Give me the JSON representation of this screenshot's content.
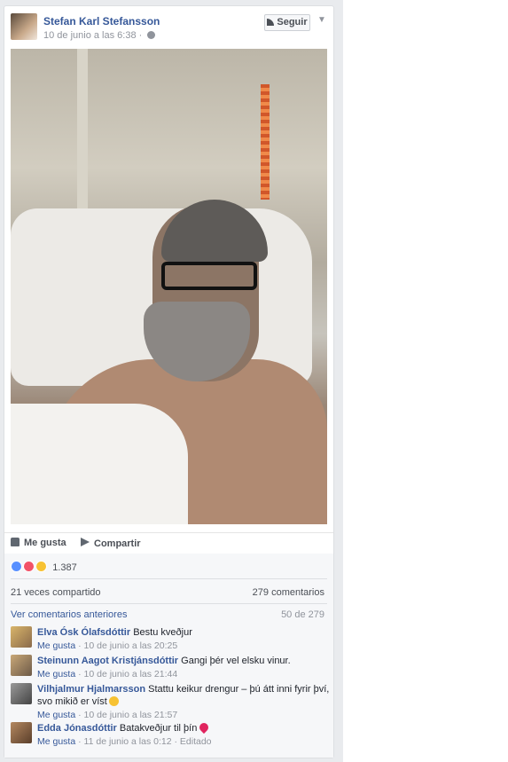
{
  "post": {
    "author": "Stefan Karl Stefansson",
    "timestamp": "10 de junio a las 6:38 ·",
    "follow_label": "Seguir",
    "actions": {
      "like": "Me gusta",
      "share": "Compartir"
    },
    "reactions_count": "1.387",
    "shared": "21 veces compartido",
    "comments_total": "279 comentarios",
    "view_previous": "Ver comentarios anteriores",
    "pager": "50 de 279"
  },
  "comments": [
    {
      "name": "Elva Ósk Ólafsdóttir",
      "text": "Bestu kveðjur",
      "like": "Me gusta",
      "meta": " · 10 de junio a las 20:25"
    },
    {
      "name": "Steinunn Aagot Kristjánsdóttir",
      "text": "Gangi þér vel elsku vinur.",
      "like": "Me gusta",
      "meta": " · 10 de junio a las 21:44"
    },
    {
      "name": "Vilhjalmur Hjalmarsson",
      "text": "Stattu keikur drengur – þú átt inni fyrir því, svo mikið er víst",
      "like": "Me gusta",
      "meta": " · 10 de junio a las 21:57"
    },
    {
      "name": "Edda Jónasdóttir",
      "text": "Batakveðjur til þín",
      "like": "Me gusta",
      "meta": " · 11 de junio a las 0:12 · Editado"
    }
  ],
  "colors": {
    "link": "#365899",
    "muted": "#90949c",
    "like": "#5890ff",
    "love": "#f25268",
    "sad": "#f7c233"
  }
}
